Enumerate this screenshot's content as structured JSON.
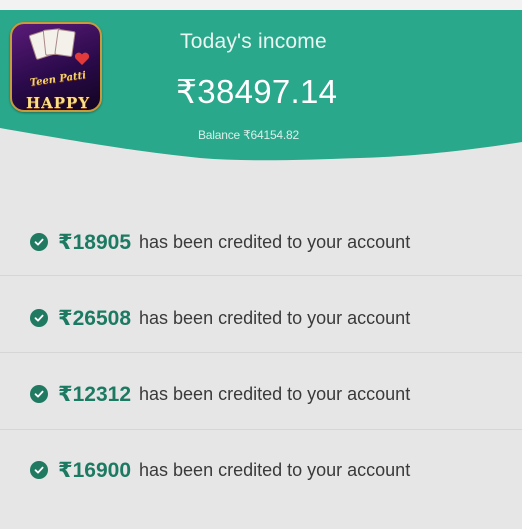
{
  "app": {
    "logo_top_text": "Teen Patti",
    "logo_brand_text": "HAPPY"
  },
  "header": {
    "income_label": "Today's income",
    "income_amount": "₹38497.14",
    "balance_text": "Balance ₹64154.82"
  },
  "credits": [
    {
      "amount": "₹18905",
      "message": "has been credited to your account"
    },
    {
      "amount": "₹26508",
      "message": "has been credited to your account"
    },
    {
      "amount": "₹12312",
      "message": "has been credited to your account"
    },
    {
      "amount": "₹16900",
      "message": "has been credited to your account"
    }
  ],
  "colors": {
    "header_teal": "#2aa88b",
    "accent_green": "#1d7a62",
    "background": "#e6e6e6"
  },
  "icons": {
    "row_icon": "check-circle-icon"
  }
}
